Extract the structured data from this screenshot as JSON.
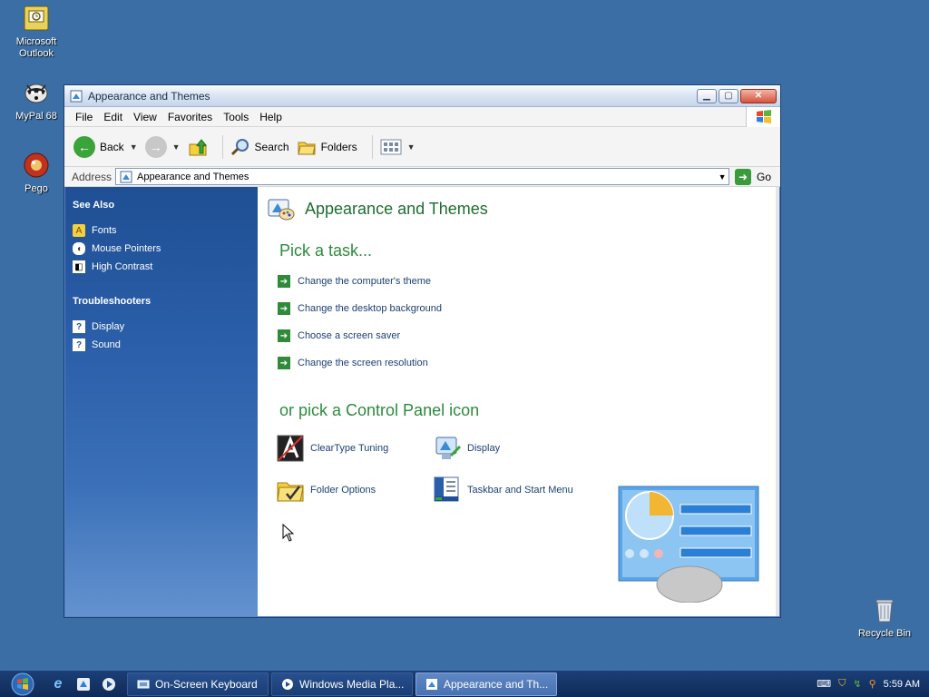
{
  "desktop": {
    "icons": [
      {
        "label": "Microsoft Outlook"
      },
      {
        "label": "MyPal 68"
      },
      {
        "label": "Pego"
      },
      {
        "label": "Recycle Bin"
      }
    ]
  },
  "window": {
    "title": "Appearance and Themes",
    "menu": [
      "File",
      "Edit",
      "View",
      "Favorites",
      "Tools",
      "Help"
    ],
    "toolbar": {
      "back": "Back",
      "search": "Search",
      "folders": "Folders"
    },
    "address": {
      "label": "Address",
      "value": "Appearance and Themes",
      "go": "Go"
    },
    "sidebar": {
      "see_also_title": "See Also",
      "see_also": [
        "Fonts",
        "Mouse Pointers",
        "High Contrast"
      ],
      "troubleshooters_title": "Troubleshooters",
      "troubleshooters": [
        "Display",
        "Sound"
      ]
    },
    "main": {
      "heading": "Appearance and Themes",
      "pick_task": "Pick a task...",
      "tasks": [
        "Change the computer's theme",
        "Change the desktop background",
        "Choose a screen saver",
        "Change the screen resolution"
      ],
      "pick_icon": "or pick a Control Panel icon",
      "icons": [
        "ClearType Tuning",
        "Display",
        "Folder Options",
        "Taskbar and Start Menu"
      ]
    }
  },
  "taskbar": {
    "buttons": [
      "On-Screen Keyboard",
      "Windows Media Pla...",
      "Appearance and Th..."
    ],
    "clock": "5:59 AM"
  },
  "colors": {
    "desktop": "#3a6ea5",
    "heading_green": "#2d8a3d",
    "link_blue": "#1c3f74",
    "sidebar_blue": "#2a5ea8"
  }
}
